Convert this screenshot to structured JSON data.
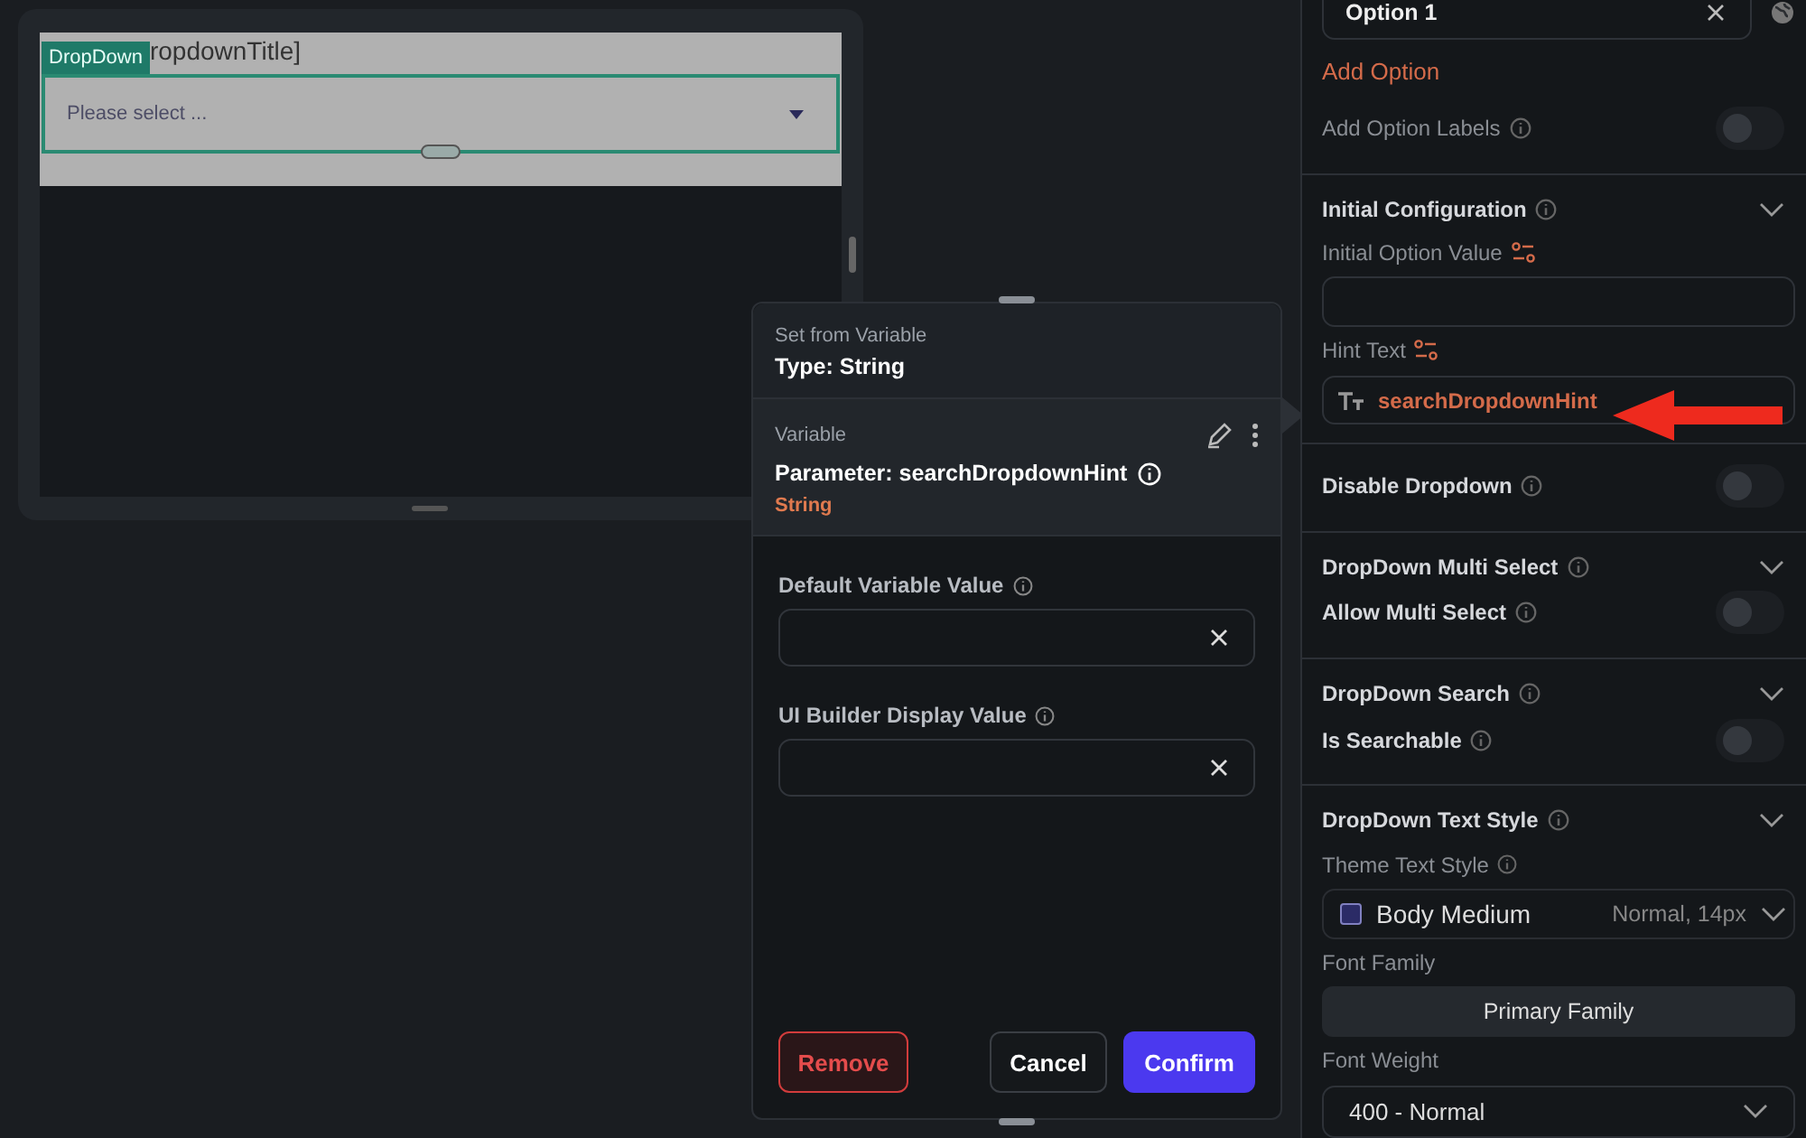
{
  "canvas": {
    "badge": "DropDown",
    "title": "ropdownTitle]",
    "hint": "Please select ..."
  },
  "popup": {
    "eyebrow": "Set from Variable",
    "type": "Type: String",
    "variable_label": "Variable",
    "parameter": "Parameter: searchDropdownHint",
    "param_type": "String",
    "fields": [
      {
        "label": "Default Variable Value"
      },
      {
        "label": "UI Builder Display Value"
      }
    ],
    "remove": "Remove",
    "cancel": "Cancel",
    "confirm": "Confirm"
  },
  "panel": {
    "option": "Option 1",
    "add_option": "Add Option",
    "rows": [
      {
        "kind": "toggle",
        "label": "Add Option Labels",
        "info": true,
        "on": false,
        "disabled": true
      },
      {
        "kind": "divider"
      },
      {
        "kind": "section",
        "label": "Initial Configuration",
        "info": true,
        "expanded": true
      },
      {
        "kind": "label",
        "label": "Initial Option Value",
        "bindable": true
      },
      {
        "kind": "field"
      },
      {
        "kind": "label",
        "label": "Hint Text",
        "bindable": true
      },
      {
        "kind": "bound_field",
        "value": "searchDropdownHint"
      },
      {
        "kind": "divider"
      },
      {
        "kind": "toggle",
        "label": "Disable Dropdown",
        "info": true,
        "on": false,
        "disabled": false
      },
      {
        "kind": "divider"
      },
      {
        "kind": "section",
        "label": "DropDown Multi Select",
        "info": true,
        "expanded": true
      },
      {
        "kind": "toggle",
        "label": "Allow Multi Select",
        "info": true,
        "on": false,
        "disabled": false
      },
      {
        "kind": "divider"
      },
      {
        "kind": "section",
        "label": "DropDown Search",
        "info": true,
        "expanded": true
      },
      {
        "kind": "toggle",
        "label": "Is Searchable",
        "info": true,
        "on": false,
        "disabled": false
      },
      {
        "kind": "divider"
      },
      {
        "kind": "section",
        "label": "DropDown Text Style",
        "info": true,
        "expanded": true
      },
      {
        "kind": "label",
        "label": "Theme Text Style",
        "info": true
      },
      {
        "kind": "style_select",
        "value": "Body Medium",
        "detail": "Normal, 14px"
      },
      {
        "kind": "label",
        "label": "Font Family"
      },
      {
        "kind": "button",
        "label": "Primary Family"
      },
      {
        "kind": "label",
        "label": "Font Weight"
      },
      {
        "kind": "select",
        "value": "400 - Normal"
      }
    ]
  }
}
